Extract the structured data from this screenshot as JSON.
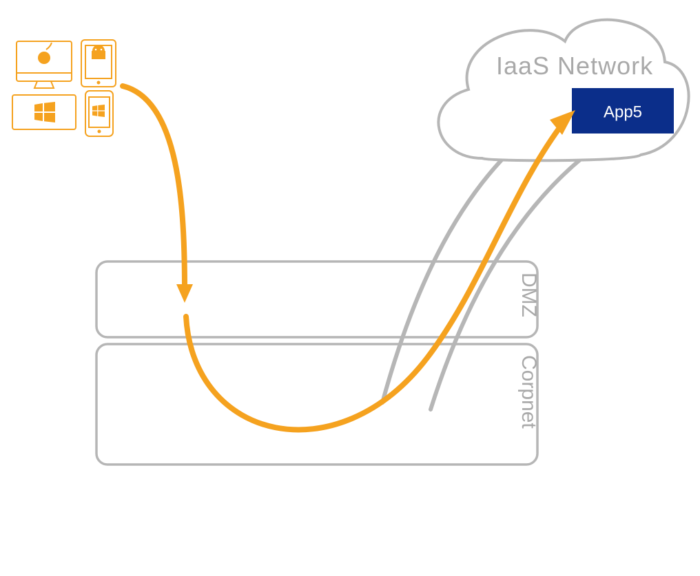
{
  "cloud": {
    "title": "IaaS Network",
    "app_label": "App5"
  },
  "zones": {
    "dmz_label": "DMZ",
    "corpnet_label": "Corpnet"
  },
  "colors": {
    "accent": "#f5a21f",
    "gray": "#b6b6b6",
    "gray_text": "#a9a9a9",
    "app_fill": "#0b2e8a"
  }
}
